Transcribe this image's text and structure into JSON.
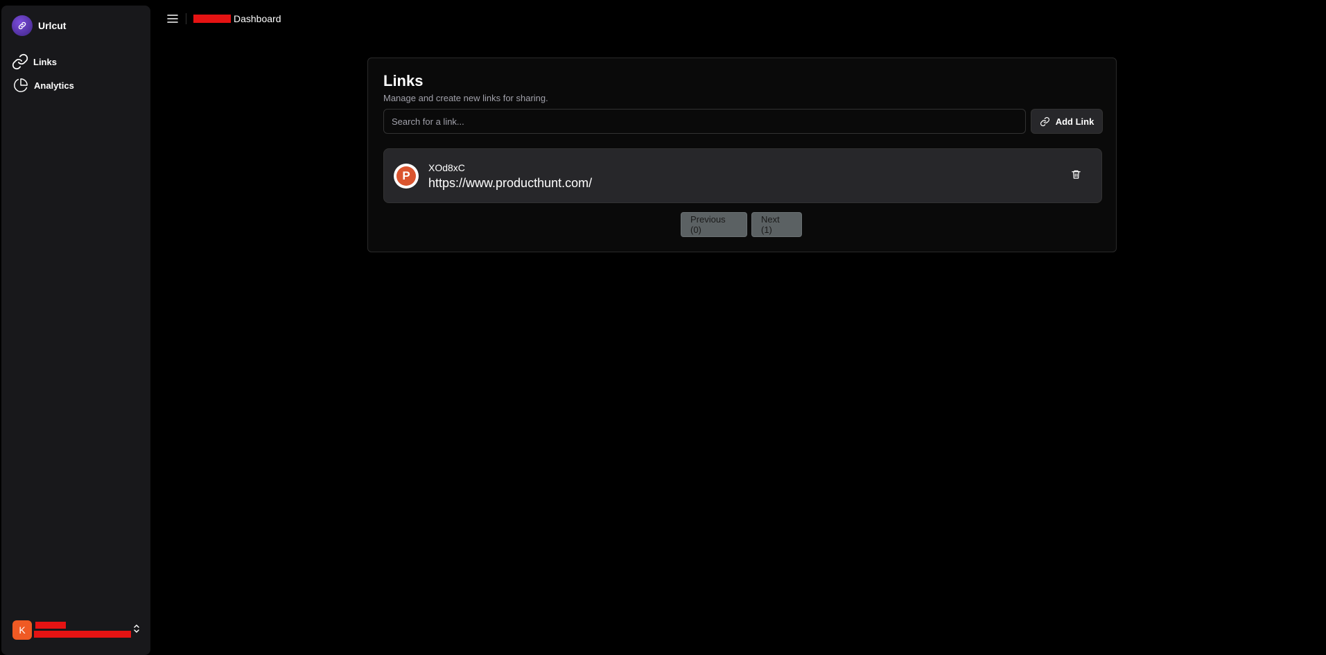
{
  "app": {
    "name": "Urlcut"
  },
  "sidebar": {
    "items": [
      {
        "label": "Links",
        "icon": "link-icon"
      },
      {
        "label": "Analytics",
        "icon": "pie-chart-icon"
      }
    ],
    "user": {
      "avatar_initial": "K"
    }
  },
  "header": {
    "breadcrumb": "Dashboard"
  },
  "links_card": {
    "title": "Links",
    "subtitle": "Manage and create new links for sharing.",
    "search_placeholder": "Search for a link...",
    "add_button_label": "Add Link",
    "items": [
      {
        "favicon_letter": "P",
        "favicon_color": "#da552f",
        "short_code": "XOd8xC",
        "url": "https://www.producthunt.com/"
      }
    ],
    "pagination": {
      "previous_label": "Previous (0)",
      "next_label": "Next (1)"
    }
  },
  "colors": {
    "background": "#000000",
    "sidebar": "#18181b",
    "accent_brand": "#5b34b8",
    "avatar": "#f05a24",
    "redaction": "#e51313"
  }
}
